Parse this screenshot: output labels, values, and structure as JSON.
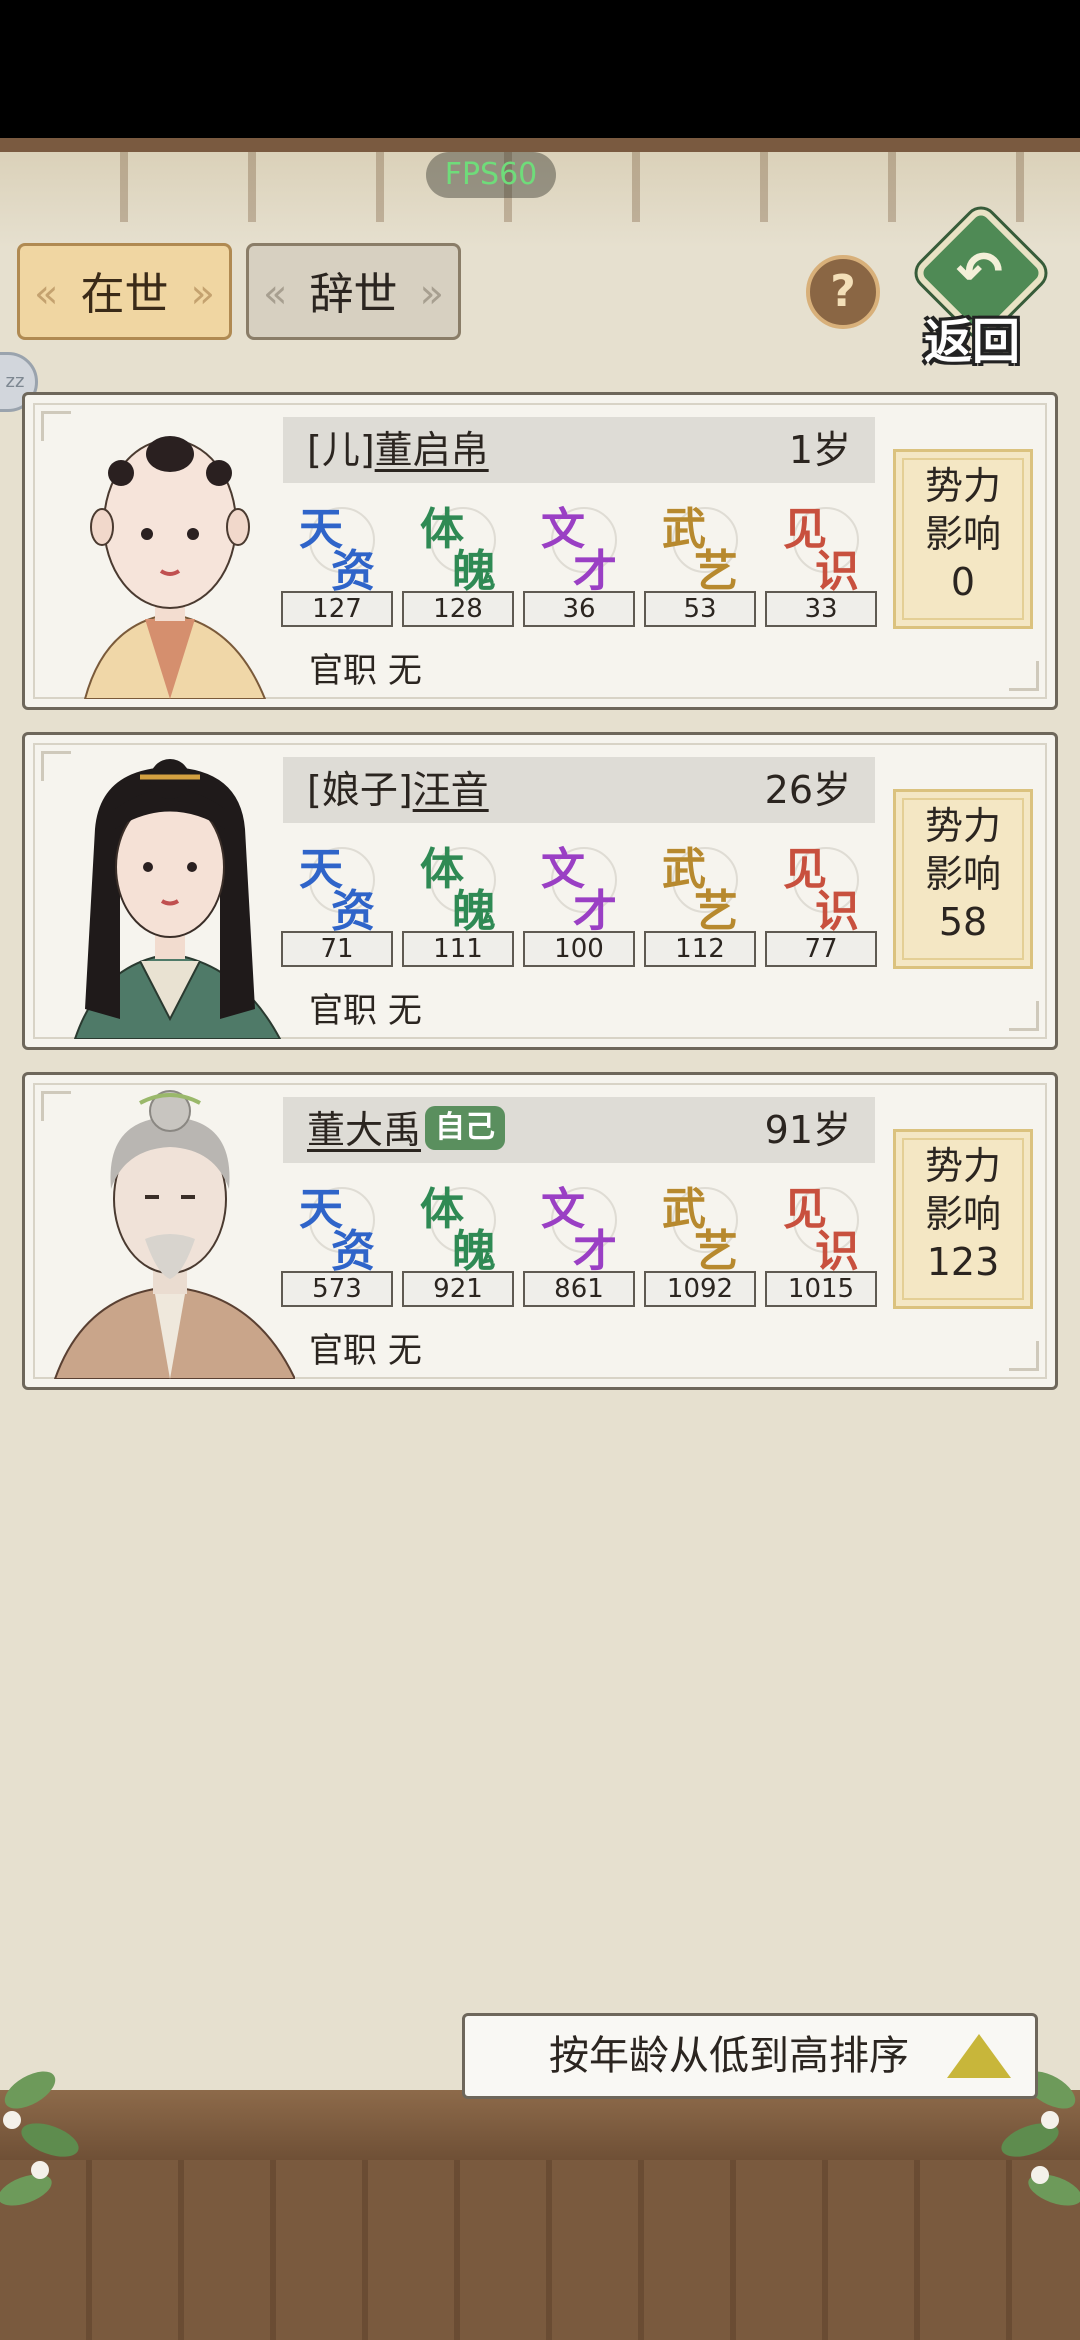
{
  "overlay": {
    "fps": "FPS60"
  },
  "tabs": [
    {
      "label": "在世",
      "active": true
    },
    {
      "label": "辞世",
      "active": false
    }
  ],
  "header": {
    "help_label": "?",
    "back_label": "返回"
  },
  "side_tab": {
    "label": "zz"
  },
  "stat_labels": [
    {
      "c1": "天",
      "c2": "资",
      "color": "#2f64c9"
    },
    {
      "c1": "体",
      "c2": "魄",
      "color": "#2f8a54"
    },
    {
      "c1": "文",
      "c2": "才",
      "color": "#9a3fc4"
    },
    {
      "c1": "武",
      "c2": "艺",
      "color": "#b7892e"
    },
    {
      "c1": "见",
      "c2": "识",
      "color": "#c8503e"
    }
  ],
  "members": [
    {
      "prefix": "[儿]",
      "name": "董启帛",
      "self_badge": "",
      "age": "1岁",
      "stats": [
        "127",
        "128",
        "36",
        "53",
        "33"
      ],
      "office_label": "官职",
      "office_value": "无",
      "influence_line1": "势力",
      "influence_line2": "影响",
      "influence_value": "0"
    },
    {
      "prefix": "[娘子]",
      "name": "汪音",
      "self_badge": "",
      "age": "26岁",
      "stats": [
        "71",
        "111",
        "100",
        "112",
        "77"
      ],
      "office_label": "官职",
      "office_value": "无",
      "influence_line1": "势力",
      "influence_line2": "影响",
      "influence_value": "58"
    },
    {
      "prefix": "",
      "name": "董大禹",
      "self_badge": "自己",
      "age": "91岁",
      "stats": [
        "573",
        "921",
        "861",
        "1092",
        "1015"
      ],
      "office_label": "官职",
      "office_value": "无",
      "influence_line1": "势力",
      "influence_line2": "影响",
      "influence_value": "123"
    }
  ],
  "sort": {
    "label": "按年龄从低到高排序"
  }
}
